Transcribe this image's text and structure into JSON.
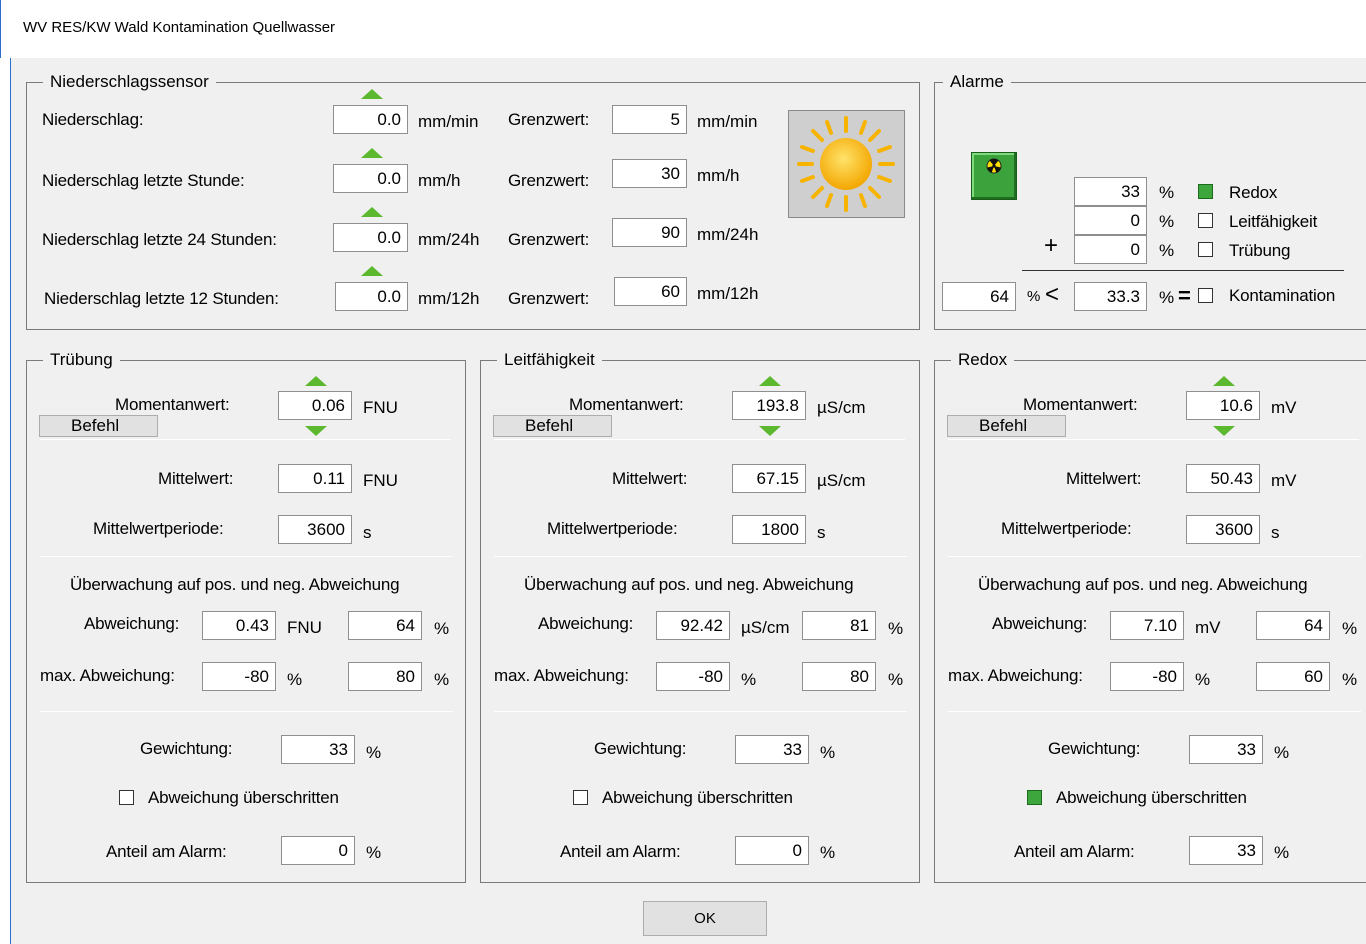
{
  "window": {
    "title": "WV RES/KW Wald Kontamination Quellwasser"
  },
  "nieder": {
    "legend": "Niederschlagssensor",
    "grenz_label": "Grenzwert:",
    "rows": [
      {
        "label": "Niederschlag:",
        "value": "0.0",
        "unit": "mm/min",
        "grenz": "5",
        "grenz_unit": "mm/min"
      },
      {
        "label": "Niederschlag letzte Stunde:",
        "value": "0.0",
        "unit": "mm/h",
        "grenz": "30",
        "grenz_unit": "mm/h"
      },
      {
        "label": "Niederschlag letzte 24 Stunden:",
        "value": "0.0",
        "unit": "mm/24h",
        "grenz": "90",
        "grenz_unit": "mm/24h"
      },
      {
        "label": "Niederschlag letzte 12 Stunden:",
        "value": "0.0",
        "unit": "mm/12h",
        "grenz": "60",
        "grenz_unit": "mm/12h"
      }
    ],
    "weather_icon": "sun-icon"
  },
  "alarme": {
    "legend": "Alarme",
    "indicator_icon": "radiation-icon",
    "rows": [
      {
        "value": "33",
        "unit": "%",
        "label": "Redox",
        "checked": true
      },
      {
        "value": "0",
        "unit": "%",
        "label": "Leitfähigkeit",
        "checked": false
      },
      {
        "value": "0",
        "unit": "%",
        "label": "Trübung",
        "checked": false
      }
    ],
    "plus": "+",
    "result_left": "64",
    "result_left_unit": "%",
    "lt": "<",
    "threshold": "33.3",
    "threshold_unit": "%",
    "eq": "=",
    "kontamination_label": "Kontamination",
    "kontamination_checked": false
  },
  "panels": [
    {
      "legend": "Trübung",
      "moment_label": "Momentanwert:",
      "moment_value": "0.06",
      "moment_unit": "FNU",
      "befehl": "Befehl",
      "mittel_label": "Mittelwert:",
      "mittel_value": "0.11",
      "mittel_unit": "FNU",
      "periode_label": "Mittelwertperiode:",
      "periode_value": "3600",
      "periode_unit": "s",
      "ueberwachung": "Überwachung auf pos. und neg. Abweichung",
      "abw_label": "Abweichung:",
      "abw_value": "0.43",
      "abw_unit": "FNU",
      "abw_pct": "64",
      "pct": "%",
      "maxabw_label": "max. Abweichung:",
      "maxabw_neg": "-80",
      "maxabw_pos": "80",
      "gew_label": "Gewichtung:",
      "gew_value": "33",
      "ueber_label": "Abweichung überschritten",
      "ueber_checked": false,
      "anteil_label": "Anteil am Alarm:",
      "anteil_value": "0"
    },
    {
      "legend": "Leitfähigkeit",
      "moment_label": "Momentanwert:",
      "moment_value": "193.8",
      "moment_unit": "µS/cm",
      "befehl": "Befehl",
      "mittel_label": "Mittelwert:",
      "mittel_value": "67.15",
      "mittel_unit": "µS/cm",
      "periode_label": "Mittelwertperiode:",
      "periode_value": "1800",
      "periode_unit": "s",
      "ueberwachung": "Überwachung auf pos. und neg. Abweichung",
      "abw_label": "Abweichung:",
      "abw_value": "92.42",
      "abw_unit": "µS/cm",
      "abw_pct": "81",
      "pct": "%",
      "maxabw_label": "max. Abweichung:",
      "maxabw_neg": "-80",
      "maxabw_pos": "80",
      "gew_label": "Gewichtung:",
      "gew_value": "33",
      "ueber_label": "Abweichung überschritten",
      "ueber_checked": false,
      "anteil_label": "Anteil am Alarm:",
      "anteil_value": "0"
    },
    {
      "legend": "Redox",
      "moment_label": "Momentanwert:",
      "moment_value": "10.6",
      "moment_unit": "mV",
      "befehl": "Befehl",
      "mittel_label": "Mittelwert:",
      "mittel_value": "50.43",
      "mittel_unit": "mV",
      "periode_label": "Mittelwertperiode:",
      "periode_value": "3600",
      "periode_unit": "s",
      "ueberwachung": "Überwachung auf pos. und neg. Abweichung",
      "abw_label": "Abweichung:",
      "abw_value": "7.10",
      "abw_unit": "mV",
      "abw_pct": "64",
      "pct": "%",
      "maxabw_label": "max. Abweichung:",
      "maxabw_neg": "-80",
      "maxabw_pos": "60",
      "gew_label": "Gewichtung:",
      "gew_value": "33",
      "ueber_label": "Abweichung überschritten",
      "ueber_checked": true,
      "anteil_label": "Anteil am Alarm:",
      "anteil_value": "33"
    }
  ],
  "ok_label": "OK"
}
